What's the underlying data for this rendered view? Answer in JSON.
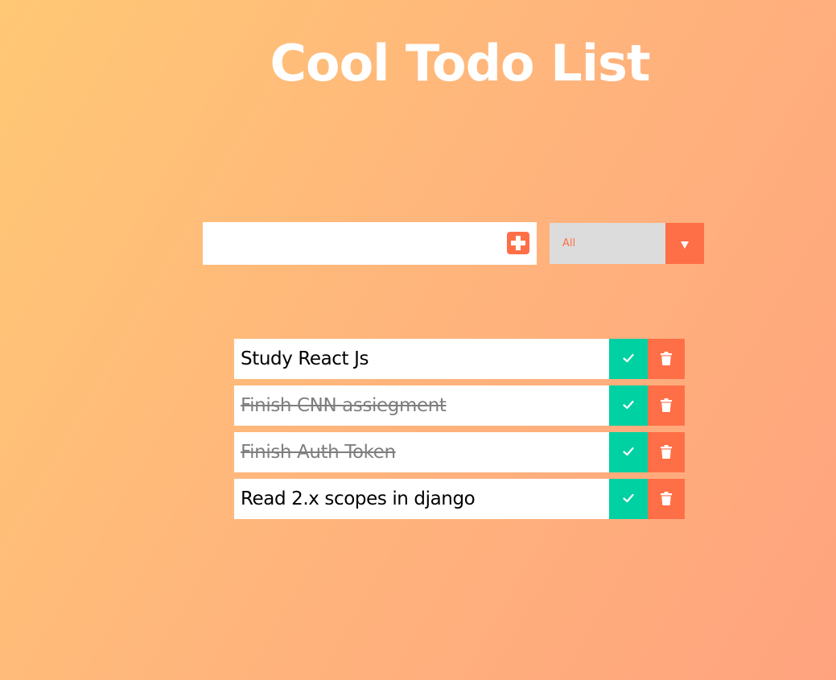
{
  "header": {
    "title": "Cool Todo List"
  },
  "form": {
    "input_value": "",
    "input_placeholder": "",
    "add_icon": "plus-square-icon",
    "filter": {
      "selected": "All",
      "arrow_icon": "caret-down-icon"
    }
  },
  "todos": [
    {
      "text": "Study React Js",
      "completed": false
    },
    {
      "text": "Finish CNN assiegment",
      "completed": true
    },
    {
      "text": "Finish Auth Token",
      "completed": true
    },
    {
      "text": "Read 2.x scopes in django",
      "completed": false
    }
  ],
  "icons": {
    "complete": "check-icon",
    "delete": "trash-icon"
  },
  "colors": {
    "accent": "#ff6f47",
    "complete": "#00d1a2",
    "select_bg": "#dcdcdc",
    "title": "#ffffff"
  }
}
